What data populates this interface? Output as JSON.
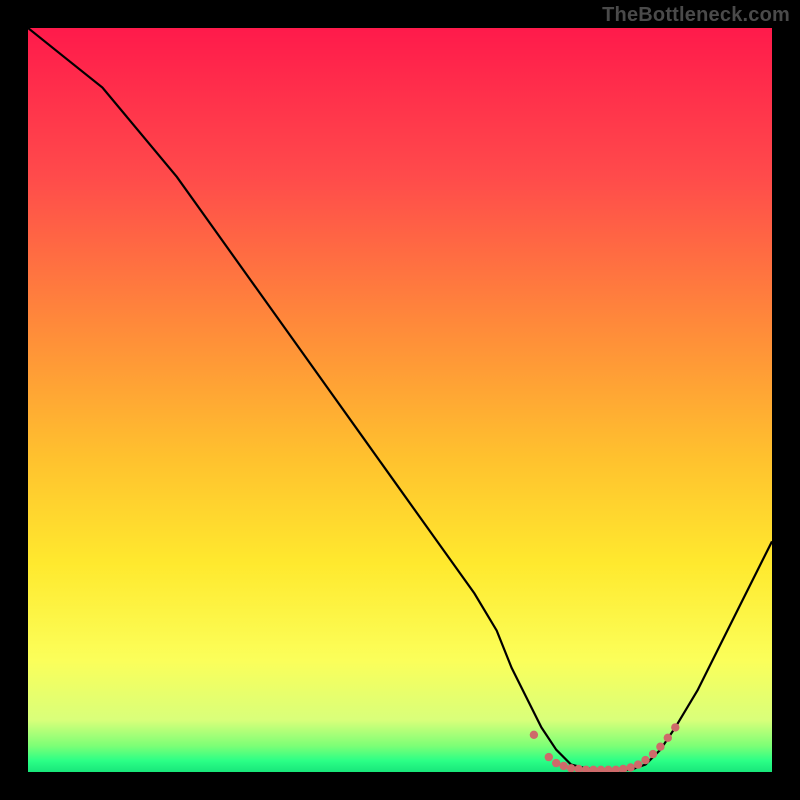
{
  "watermark": "TheBottleneck.com",
  "chart_data": {
    "type": "line",
    "title": "",
    "xlabel": "",
    "ylabel": "",
    "xlim": [
      0,
      100
    ],
    "ylim": [
      0,
      100
    ],
    "grid": false,
    "legend": false,
    "series": [
      {
        "name": "bottleneck-curve",
        "color": "#000000",
        "x": [
          0,
          5,
          10,
          15,
          20,
          25,
          30,
          35,
          40,
          45,
          50,
          55,
          60,
          63,
          65,
          67,
          69,
          71,
          73,
          75,
          77,
          79,
          81,
          83,
          85,
          87,
          90,
          93,
          96,
          98,
          100
        ],
        "y": [
          100,
          96,
          92,
          86,
          80,
          73,
          66,
          59,
          52,
          45,
          38,
          31,
          24,
          19,
          14,
          10,
          6,
          3,
          1,
          0.5,
          0.3,
          0.2,
          0.3,
          1,
          3,
          6,
          11,
          17,
          23,
          27,
          31
        ]
      },
      {
        "name": "optimal-band-marker",
        "color": "#ce6a6a",
        "style": "dotted-thick",
        "x": [
          68,
          70,
          71,
          72,
          73,
          74,
          75,
          76,
          77,
          78,
          79,
          80,
          81,
          82,
          83,
          84,
          85,
          86,
          87
        ],
        "y": [
          5,
          2,
          1.2,
          0.8,
          0.5,
          0.4,
          0.3,
          0.3,
          0.3,
          0.3,
          0.3,
          0.4,
          0.6,
          1.0,
          1.6,
          2.4,
          3.4,
          4.6,
          6.0
        ]
      }
    ],
    "background": {
      "type": "vertical-gradient",
      "stops": [
        {
          "pos": 0.0,
          "color": "#ff1a4b"
        },
        {
          "pos": 0.2,
          "color": "#ff4b4b"
        },
        {
          "pos": 0.4,
          "color": "#ff8a3a"
        },
        {
          "pos": 0.58,
          "color": "#ffc22e"
        },
        {
          "pos": 0.72,
          "color": "#ffe92e"
        },
        {
          "pos": 0.85,
          "color": "#fbff5a"
        },
        {
          "pos": 0.93,
          "color": "#d9ff7a"
        },
        {
          "pos": 0.965,
          "color": "#7cff76"
        },
        {
          "pos": 0.985,
          "color": "#2bff86"
        },
        {
          "pos": 1.0,
          "color": "#18e67a"
        }
      ]
    }
  }
}
